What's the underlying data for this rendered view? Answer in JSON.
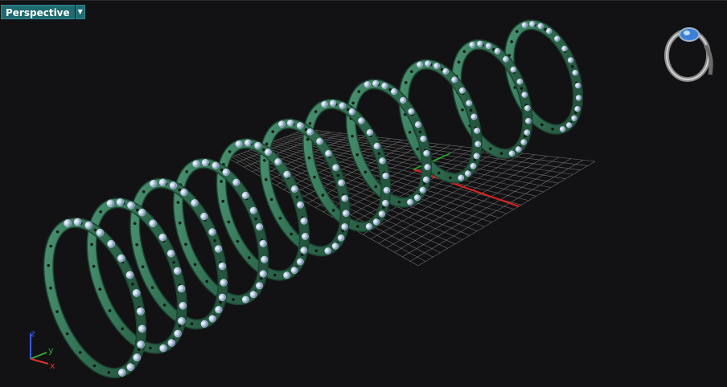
{
  "viewport": {
    "title": "Perspective",
    "dropdown_icon": "chevron-down-icon"
  },
  "gizmo": {
    "x_label": "x",
    "y_label": "y",
    "z_label": "z",
    "x_color": "#e03030",
    "y_color": "#3aa83a",
    "z_color": "#3a5ae8"
  },
  "scene": {
    "ring_color": "#2f6b4f",
    "ring_highlight": "#4f9a78",
    "gem_color": "#b9cde8",
    "grid_color": "#7a7a7a",
    "ring_count": 11
  }
}
